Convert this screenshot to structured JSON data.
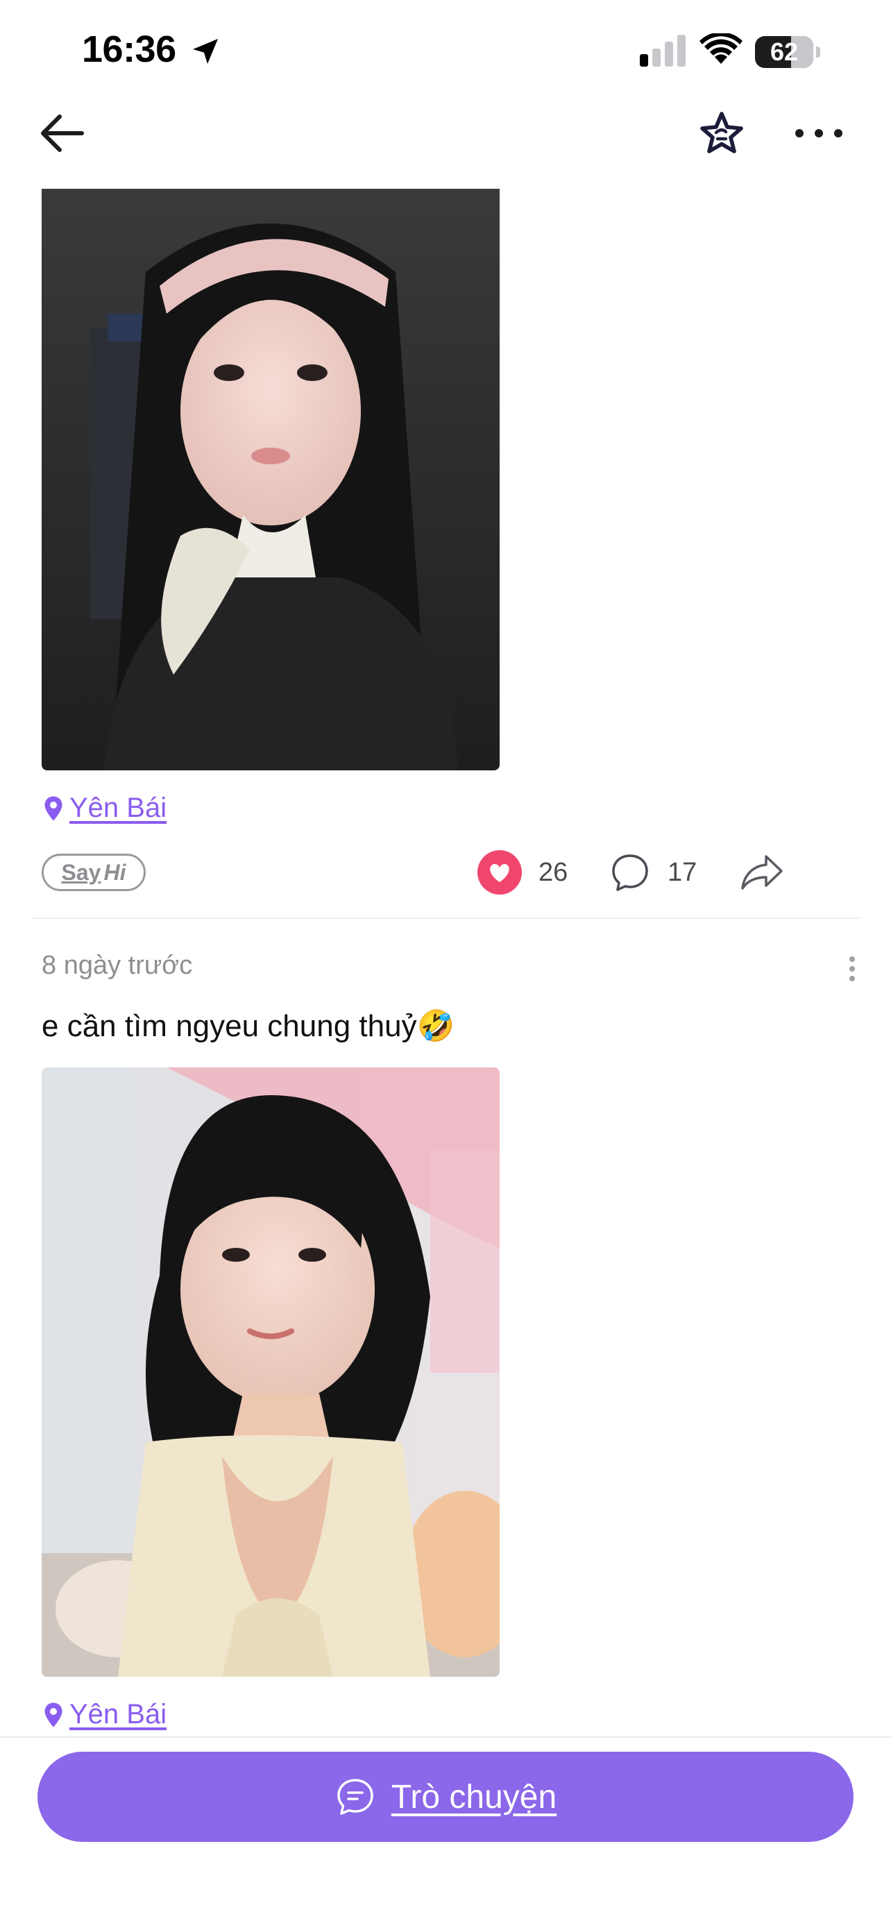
{
  "status_bar": {
    "time": "16:36",
    "battery": "62",
    "battery_level": 0.62
  },
  "nav": {
    "back_icon": "arrow-left-icon",
    "star_icon": "star-icon",
    "more_icon": "more-horizontal-icon"
  },
  "posts": [
    {
      "photo_alt": "",
      "location": "Yên Bái",
      "say_hi": {
        "say": "Say",
        "hi": "Hi"
      },
      "likes": "26",
      "comments": "17"
    },
    {
      "time_ago": "8 ngày trước",
      "text": "e cần tìm ngyeu chung thuỷ🤣",
      "location": "Yên Bái"
    }
  ],
  "footer": {
    "chat_label": "Trò chuyện",
    "chat_icon": "chat-bubble-icon"
  },
  "colors": {
    "accent": "#8b67ea",
    "like": "#f0466e",
    "link": "#8a5cf0"
  }
}
